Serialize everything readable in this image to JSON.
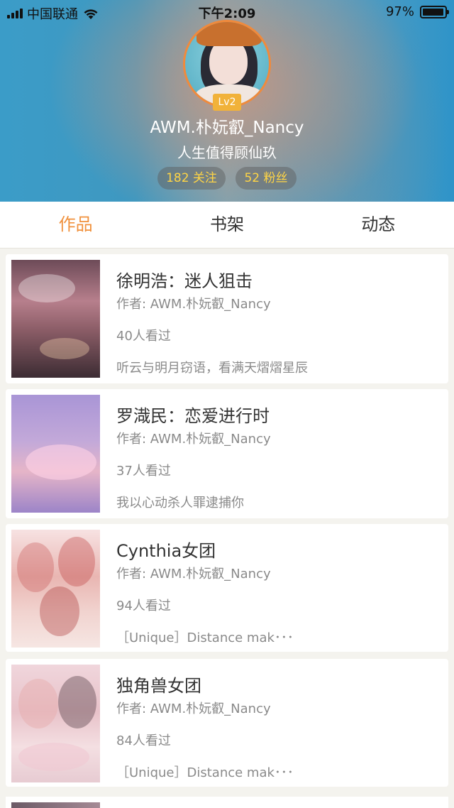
{
  "status_bar": {
    "carrier": "中国联通",
    "time": "下午2:09",
    "battery_percent": "97%",
    "battery_level": 0.97
  },
  "profile": {
    "level": "Lv2",
    "username": "AWM.朴妧叡_Nancy",
    "bio": "人生值得顾仙玖",
    "following": "182 关注",
    "fans": "52 粉丝"
  },
  "tabs": [
    {
      "label": "作品",
      "active": true
    },
    {
      "label": "书架",
      "active": false
    },
    {
      "label": "动态",
      "active": false
    }
  ],
  "works": [
    {
      "title": "徐明浩：迷人狙击",
      "author": "作者: AWM.朴妧叡_Nancy",
      "views": "40人看过",
      "desc": "听云与明月窃语，看满天熠熠星辰"
    },
    {
      "title": "罗渽民：恋爱进行时",
      "author": "作者: AWM.朴妧叡_Nancy",
      "views": "37人看过",
      "desc": "我以心动杀人罪逮捕你"
    },
    {
      "title": "Cynthia女团",
      "author": "作者: AWM.朴妧叡_Nancy",
      "views": "94人看过",
      "desc": "［Unique］Distance mak･･･"
    },
    {
      "title": "独角兽女团",
      "author": "作者: AWM.朴妧叡_Nancy",
      "views": "84人看过",
      "desc": "［Unique］Distance mak･･･"
    }
  ],
  "colors": {
    "accent": "#f0913d",
    "level_badge": "#f1b23a",
    "stat_text": "#ffd545"
  }
}
